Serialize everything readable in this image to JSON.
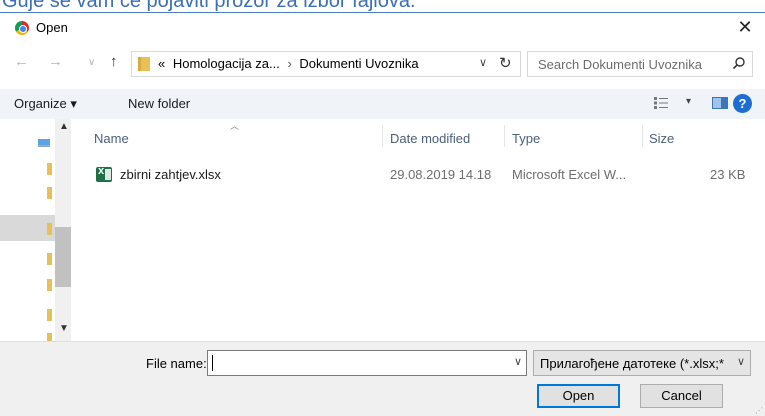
{
  "background": {
    "caption": "Guje se vam će pojaviti prozor za izbor fajlova."
  },
  "window": {
    "title": "Open",
    "close_glyph": "✕"
  },
  "navigation": {
    "back_glyph": "←",
    "forward_glyph": "→",
    "recent_glyph": "∨",
    "up_glyph": "↑",
    "breadcrumb_prefix": "«",
    "breadcrumbs": [
      "Homologacija za...",
      "Dokumenti Uvoznika"
    ],
    "separator": "›",
    "dropdown_glyph": "∨",
    "refresh_glyph": "↻"
  },
  "search": {
    "placeholder": "Search Dokumenti Uvoznika"
  },
  "toolbar": {
    "organize_label": "Organize ▾",
    "new_folder_label": "New folder",
    "view_dropdown_glyph": "▾",
    "help_glyph": "?"
  },
  "columns": {
    "name": "Name",
    "date_modified": "Date modified",
    "type": "Type",
    "size": "Size"
  },
  "files": [
    {
      "name": "zbirni zahtjev.xlsx",
      "date_modified": "29.08.2019 14.18",
      "type": "Microsoft Excel W...",
      "size": "23 KB",
      "icon": "excel-file-icon"
    }
  ],
  "footer": {
    "file_name_label": "File name:",
    "file_name_value": "",
    "file_type_filter": "Прилагођене датотеке (*.xlsx;*",
    "open_label": "Open",
    "cancel_label": "Cancel"
  },
  "colors": {
    "accent": "#0078d7",
    "toolbar_bg": "#f0f4f9",
    "excel": "#1e7145"
  }
}
